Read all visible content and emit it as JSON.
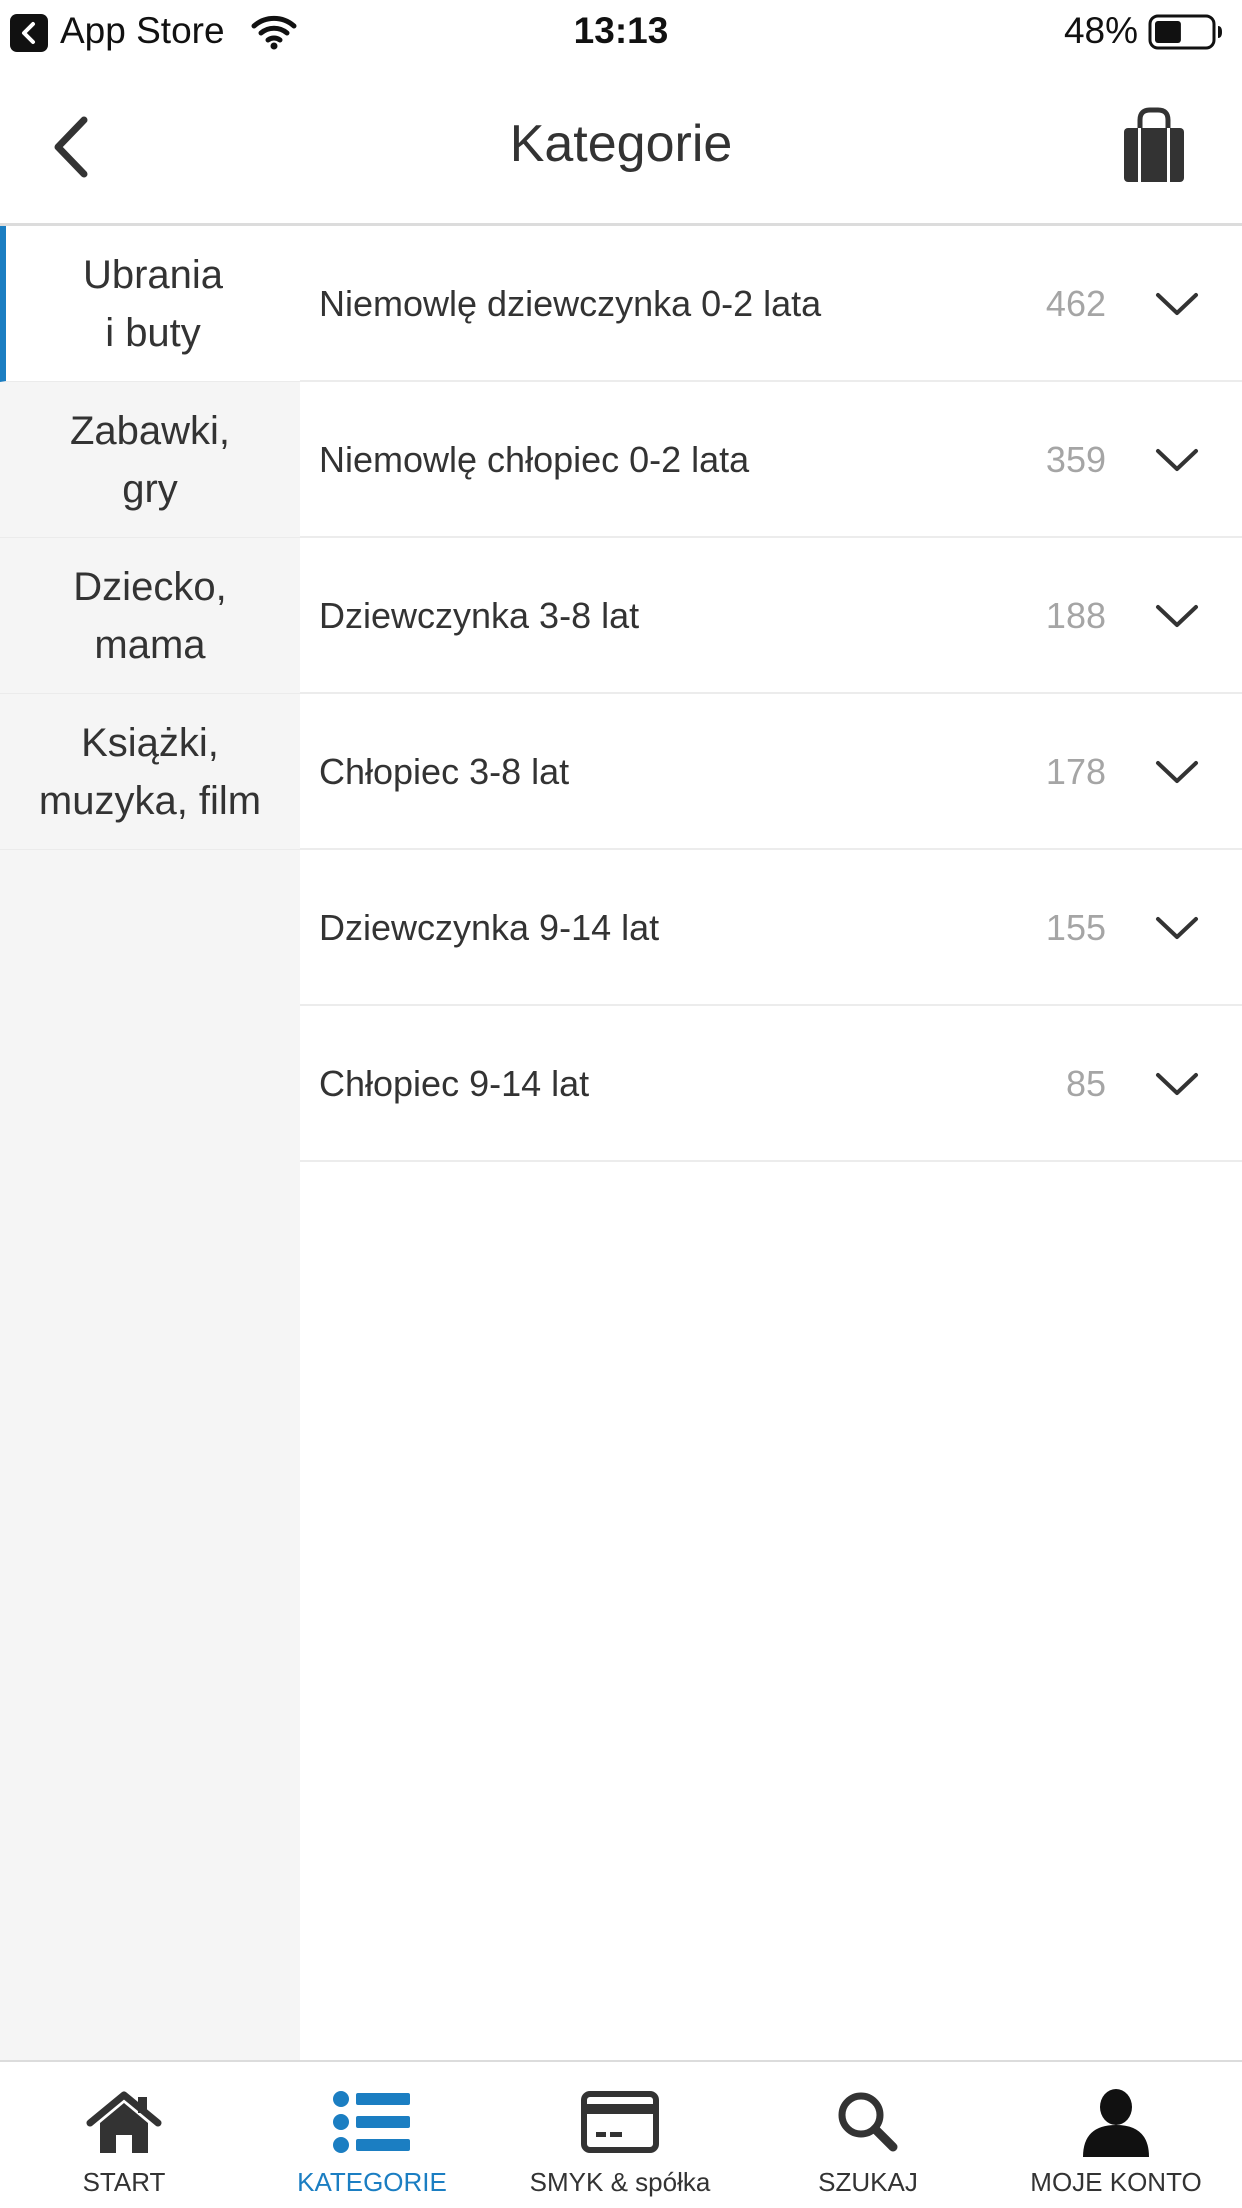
{
  "status_bar": {
    "back_app": "App Store",
    "time": "13:13",
    "battery": "48%",
    "battery_level": 0.48
  },
  "nav": {
    "title": "Kategorie",
    "back_icon": "chevron-left-icon",
    "cart_icon": "shopping-bag-icon"
  },
  "sidebar": {
    "items": [
      {
        "line1": "Ubrania",
        "line2": "i buty",
        "active": true
      },
      {
        "line1": "Zabawki,",
        "line2": "gry",
        "active": false
      },
      {
        "line1": "Dziecko,",
        "line2": "mama",
        "active": false
      },
      {
        "line1": "Książki,",
        "line2": "muzyka, film",
        "active": false
      }
    ]
  },
  "categories": [
    {
      "label": "Niemowlę dziewczynka 0-2 lata",
      "count": "462"
    },
    {
      "label": "Niemowlę chłopiec 0-2 lata",
      "count": "359"
    },
    {
      "label": "Dziewczynka 3-8 lat",
      "count": "188"
    },
    {
      "label": "Chłopiec 3-8 lat",
      "count": "178"
    },
    {
      "label": "Dziewczynka 9-14 lat",
      "count": "155"
    },
    {
      "label": "Chłopiec 9-14 lat",
      "count": "85"
    }
  ],
  "tabs": [
    {
      "label": "START",
      "icon": "home-icon"
    },
    {
      "label": "KATEGORIE",
      "icon": "list-icon",
      "active": true
    },
    {
      "label": "SMYK & spółka",
      "icon": "card-icon"
    },
    {
      "label": "SZUKAJ",
      "icon": "search-icon"
    },
    {
      "label": "MOJE KONTO",
      "icon": "user-icon"
    }
  ],
  "colors": {
    "accent": "#1b7ec2",
    "sidebar_bg": "#f5f5f5",
    "count_text": "#a5a5a5",
    "text": "#333333"
  }
}
